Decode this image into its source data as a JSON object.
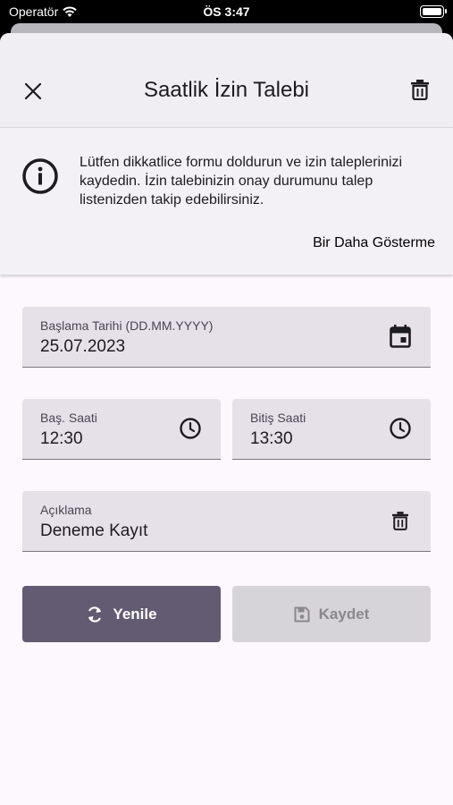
{
  "status_bar": {
    "carrier": "Operatör",
    "time": "ÖS 3:47"
  },
  "header": {
    "title": "Saatlik İzin Talebi"
  },
  "banner": {
    "message": "Lütfen dikkatlice formu doldurun ve izin taleplerinizi kaydedin. İzin talebinizin onay durumunu talep listenizden takip edebilirsiniz.",
    "dismiss_label": "Bir Daha Gösterme"
  },
  "form": {
    "start_date": {
      "label": "Başlama Tarihi (DD.MM.YYYY)",
      "value": "25.07.2023"
    },
    "start_time": {
      "label": "Baş. Saati",
      "value": "12:30"
    },
    "end_time": {
      "label": "Bitiş Saati",
      "value": "13:30"
    },
    "description": {
      "label": "Açıklama",
      "value": "Deneme Kayıt"
    }
  },
  "actions": {
    "refresh_label": "Yenile",
    "save_label": "Kaydet"
  },
  "colors": {
    "primary": "#625b71",
    "accent_link": "#6a4ea0",
    "field_bg": "#e6e0e9",
    "disabled_bg": "#d7d4d9"
  }
}
